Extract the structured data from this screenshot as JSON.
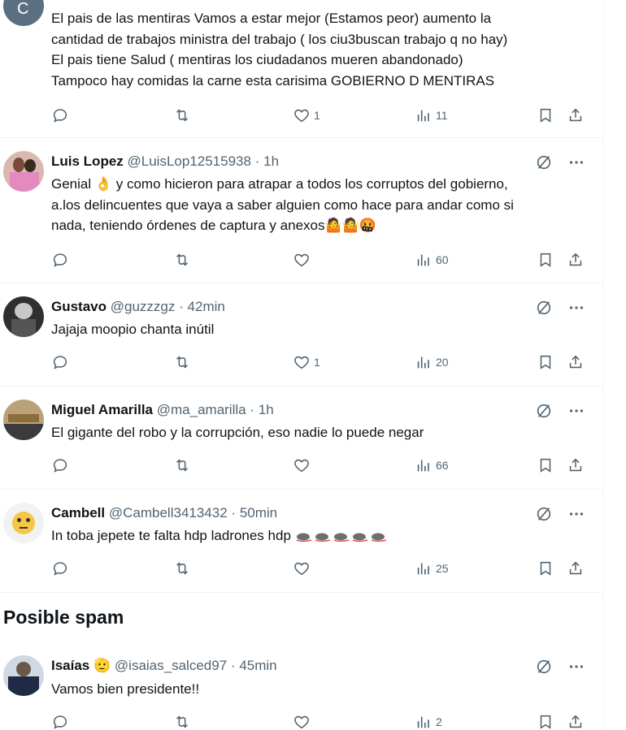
{
  "posts": [
    {
      "avatar_letter": "C",
      "avatar_color": "#5b6f82",
      "text_lines": [
        "El pais de las mentiras Vamos a estar mejor (Estamos peor) aumento la",
        "cantidad de trabajos ministra del trabajo ( los ciu3buscan trabajo q no hay)",
        "El pais tiene Salud ( mentiras los ciudadanos mueren abandonado)",
        "Tampoco hay comidas la carne esta carisima GOBIERNO D MENTIRAS"
      ],
      "likes": "1",
      "views": "11"
    },
    {
      "name": "Luis Lopez",
      "handle": "@LuisLop12515938",
      "dot": "·",
      "time": "1h",
      "text_lines": [
        "Genial 👌 y como hicieron para atrapar a todos los corruptos del gobierno,",
        "a.los delincuentes que vaya a saber alguien como hace para andar como si",
        "nada, teniendo órdenes de captura y anexos🤷🤷🤬"
      ],
      "likes": "",
      "views": "60"
    },
    {
      "name": "Gustavo",
      "handle": "@guzzzgz",
      "dot": "·",
      "time": "42min",
      "text_lines": [
        "Jajaja moopio chanta inútil"
      ],
      "likes": "1",
      "views": "20"
    },
    {
      "name": "Miguel Amarilla",
      "handle": "@ma_amarilla",
      "dot": "·",
      "time": "1h",
      "text_lines": [
        "El gigante del robo y la corrupción, eso nadie lo puede negar"
      ],
      "likes": "",
      "views": "66"
    },
    {
      "name": "Cambell",
      "handle": "@Cambell3413432",
      "dot": "·",
      "time": "50min",
      "text_lines": [
        "In toba jepete te falta hdp ladrones hdp"
      ],
      "likes": "",
      "views": "25"
    }
  ],
  "section_title": "Posible spam",
  "spam_post": {
    "name": "Isaías",
    "name_emoji": "🫡",
    "handle": "@isaias_salced97",
    "dot": "·",
    "time": "45min",
    "text_lines": [
      "Vamos bien presidente!!"
    ],
    "likes": "",
    "views": "2"
  },
  "colors": {
    "text": "#0f1419",
    "muted": "#536471",
    "border": "#eff3f4"
  }
}
